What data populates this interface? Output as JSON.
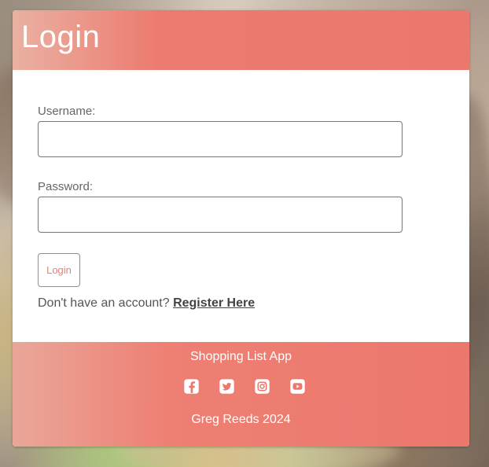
{
  "header": {
    "title": "Login"
  },
  "form": {
    "username": {
      "label": "Username:",
      "value": "",
      "placeholder": ""
    },
    "password": {
      "label": "Password:",
      "value": "",
      "placeholder": ""
    },
    "submit_label": "Login",
    "account_prompt": "Don't have an account? ",
    "register_label": "Register Here"
  },
  "footer": {
    "title": "Shopping List App",
    "credit": "Greg Reeds 2024",
    "icons": [
      "facebook-icon",
      "twitter-icon",
      "instagram-icon",
      "youtube-icon"
    ]
  },
  "colors": {
    "accent": "#ec786d",
    "text": "#555555",
    "white": "#ffffff"
  }
}
